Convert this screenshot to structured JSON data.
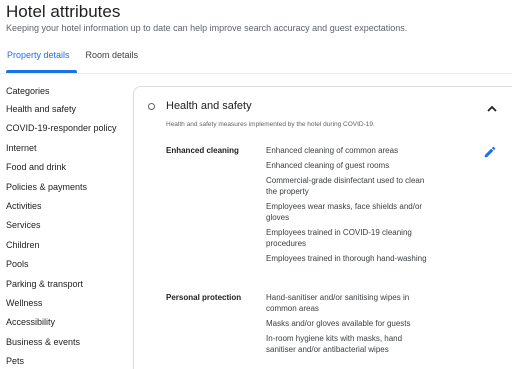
{
  "header": {
    "title": "Hotel attributes",
    "subtitle": "Keeping your hotel information up to date can help improve search accuracy and guest expectations."
  },
  "tabs": [
    {
      "label": "Property details",
      "active": true
    },
    {
      "label": "Room details",
      "active": false
    }
  ],
  "sidebar": {
    "heading": "Categories",
    "items": [
      "Health and safety",
      "COVID-19-responder policy",
      "Internet",
      "Food and drink",
      "Policies & payments",
      "Activities",
      "Services",
      "Children",
      "Pools",
      "Parking & transport",
      "Wellness",
      "Accessibility",
      "Business & events",
      "Pets"
    ]
  },
  "panel": {
    "title": "Health and safety",
    "description": "Health and safety measures implemented by the hotel during COVID-19.",
    "collapse_icon": "chevron-up-icon",
    "edit_icon": "pencil-icon",
    "groups": [
      {
        "label": "Enhanced cleaning",
        "items": [
          "Enhanced cleaning of common areas",
          "Enhanced cleaning of guest rooms",
          "Commercial-grade disinfectant used to clean the property",
          "Employees wear masks, face shields and/or gloves",
          "Employees trained in COVID-19 cleaning procedures",
          "Employees trained in thorough hand-washing"
        ]
      },
      {
        "label": "Personal protection",
        "items": [
          "Hand-sanitiser and/or sanitising wipes in common areas",
          "Masks and/or gloves available for guests",
          "In-room hygiene kits with masks, hand sanitiser and/or antibacterial wipes"
        ]
      }
    ]
  },
  "colors": {
    "accent": "#1a73e8",
    "text": "#202124",
    "muted": "#5f6368",
    "border": "#dadce0"
  }
}
